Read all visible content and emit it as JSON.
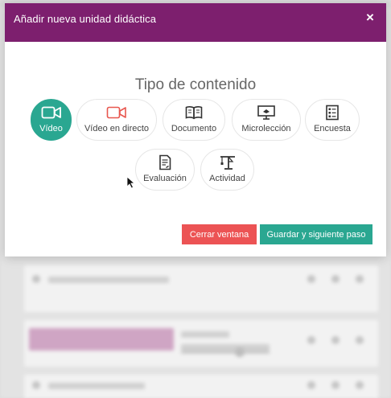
{
  "modal": {
    "title": "Añadir nueva unidad didáctica",
    "close_label": "×",
    "section_title": "Tipo de contenido",
    "content_types": [
      {
        "label": "Vídeo",
        "icon": "video-camera-icon",
        "active": true
      },
      {
        "label": "Vídeo en directo",
        "icon": "live-video-camera-icon",
        "active": false
      },
      {
        "label": "Documento",
        "icon": "book-icon",
        "active": false
      },
      {
        "label": "Microlección",
        "icon": "presentation-screen-icon",
        "active": false
      },
      {
        "label": "Encuesta",
        "icon": "checklist-icon",
        "active": false
      },
      {
        "label": "Evaluación",
        "icon": "exam-document-icon",
        "active": false
      },
      {
        "label": "Actividad",
        "icon": "crane-icon",
        "active": false
      }
    ],
    "buttons": {
      "close_window": "Cerrar ventana",
      "save_next": "Guardar y siguiente paso"
    }
  },
  "colors": {
    "header": "#7d1f6e",
    "accent_teal": "#2aa791",
    "danger_red": "#ec5354",
    "live_video_icon": "#e8574f"
  }
}
